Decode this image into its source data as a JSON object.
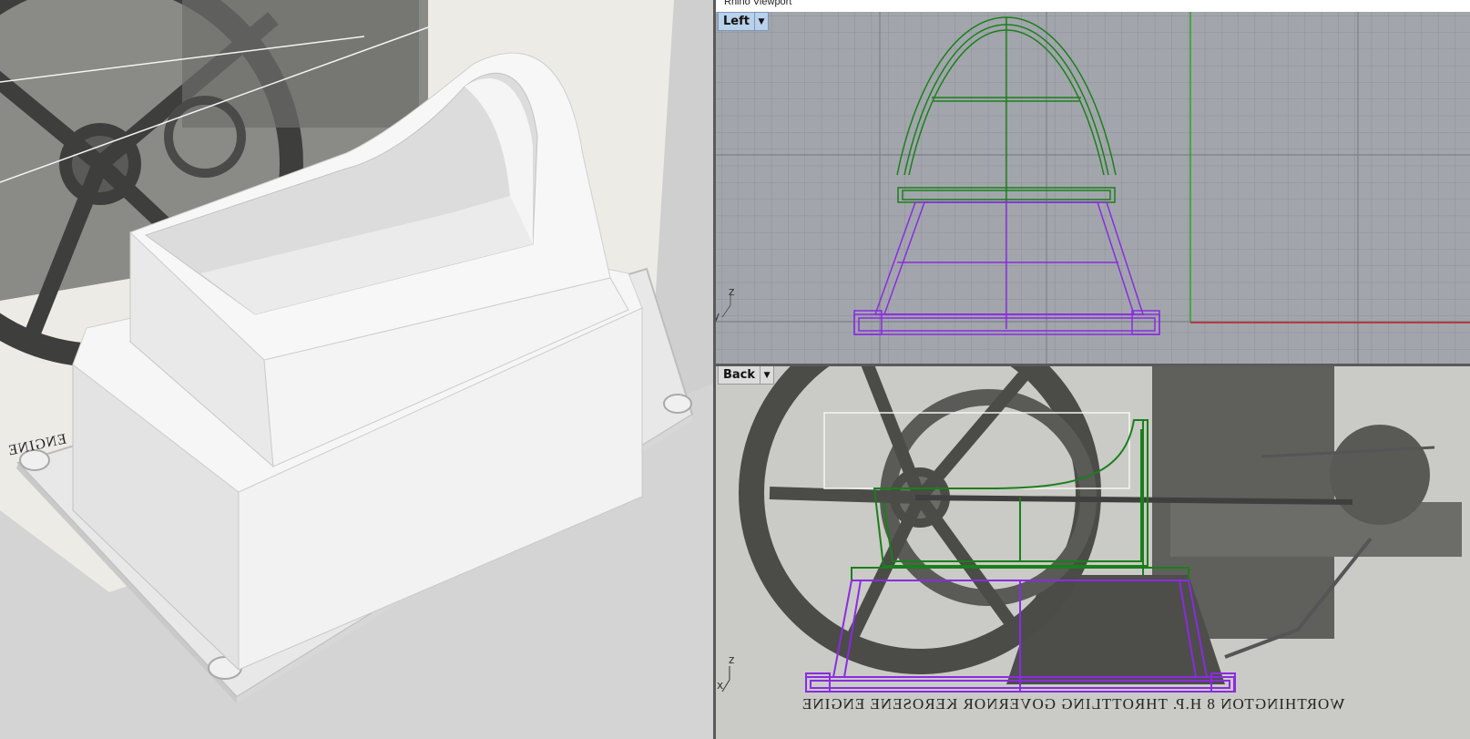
{
  "window": {
    "title": "Rhino Viewport"
  },
  "viewports": {
    "top_right": {
      "name": "Left",
      "dropdown_icon": "dropdown-arrow-icon",
      "axis_y": "y",
      "axis_z": "z"
    },
    "bottom_right": {
      "name": "Back",
      "dropdown_icon": "dropdown-arrow-icon",
      "axis_x": "x",
      "axis_z": "z"
    }
  },
  "reference_image": {
    "caption_mirrored": "WORTHINGTON 8 H.P. THROTTLING GOVERNOR KEROSENE ENGINE",
    "left_caption_fragment": "ENGINE"
  },
  "colors": {
    "curve_green": "#1a7f1a",
    "curve_purple": "#8a2be2",
    "grid_bg": "#9fa3a9",
    "axis_red": "#c0202a",
    "axis_green": "#2aa02a"
  }
}
